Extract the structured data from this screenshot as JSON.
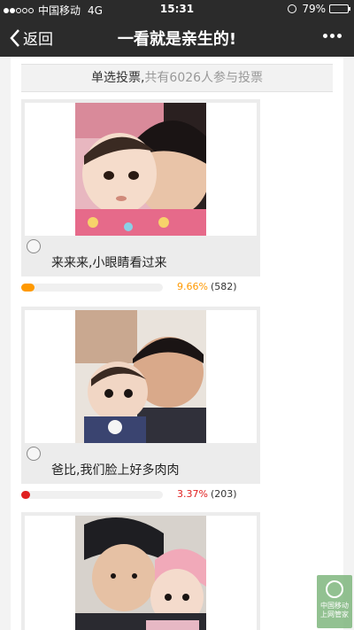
{
  "status_bar": {
    "carrier": "中国移动",
    "network": "4G",
    "time": "15:31",
    "battery": "79%",
    "battery_level": 0.79,
    "signal_bars": 2
  },
  "nav": {
    "back_label": "返回",
    "title": "一看就是亲生的!",
    "back_icon": "chevron-left-icon",
    "more_icon": "more-dots-icon"
  },
  "vote": {
    "type_label": "单选投票",
    "separator": ",",
    "participants_text": "共有6026人参与投票"
  },
  "options": [
    {
      "label": "来来来,小眼睛看过来",
      "percent_text": "9.66%",
      "count_text": "(582)",
      "fraction": 0.0966,
      "color": "#ff9900"
    },
    {
      "label": "爸比,我们脸上好多肉肉",
      "percent_text": "3.37%",
      "count_text": "(203)",
      "fraction": 0.0337,
      "color": "#e02020"
    },
    {
      "label": "",
      "percent_text": "",
      "count_text": "",
      "fraction": 0,
      "color": "#e02020"
    }
  ],
  "watermark": {
    "line1": "中国移动",
    "line2": "上网管家"
  },
  "colors": {
    "nav_bg": "#2b2b2b",
    "page_bg": "#f3f3f3"
  }
}
